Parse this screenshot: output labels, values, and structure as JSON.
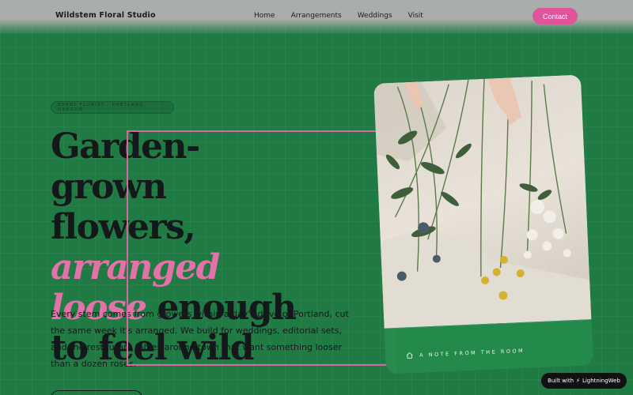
{
  "nav": {
    "brand": "Wildstem Floral Studio",
    "links": [
      "Home",
      "Arrangements",
      "Weddings",
      "Visit"
    ],
    "contact_label": "Contact"
  },
  "hero": {
    "eyebrow": "EVENT FLORIST · PORTLAND, OREGON",
    "headline_part1": "Garden-grown flowers, ",
    "headline_accent": "arranged loose",
    "headline_part2": " enough to feel wild",
    "body": "Every stem comes from growers within a day's drive of Portland, cut the same week it's arranged. We build for weddings, editorial sets, and the restaurant tables around town that want something looser than a dozen roses."
  },
  "card": {
    "caption": "A NOTE FROM THE ROOM",
    "caption_icon": "house-icon"
  },
  "badge": {
    "label_prefix": "Built with",
    "icon": "bolt-icon",
    "label_brand": "LightningWeb"
  },
  "colors": {
    "background": "#1f7a43",
    "accent_pink": "#e0559a",
    "headline_accent": "#e272a8",
    "card_green": "#248a4c"
  }
}
